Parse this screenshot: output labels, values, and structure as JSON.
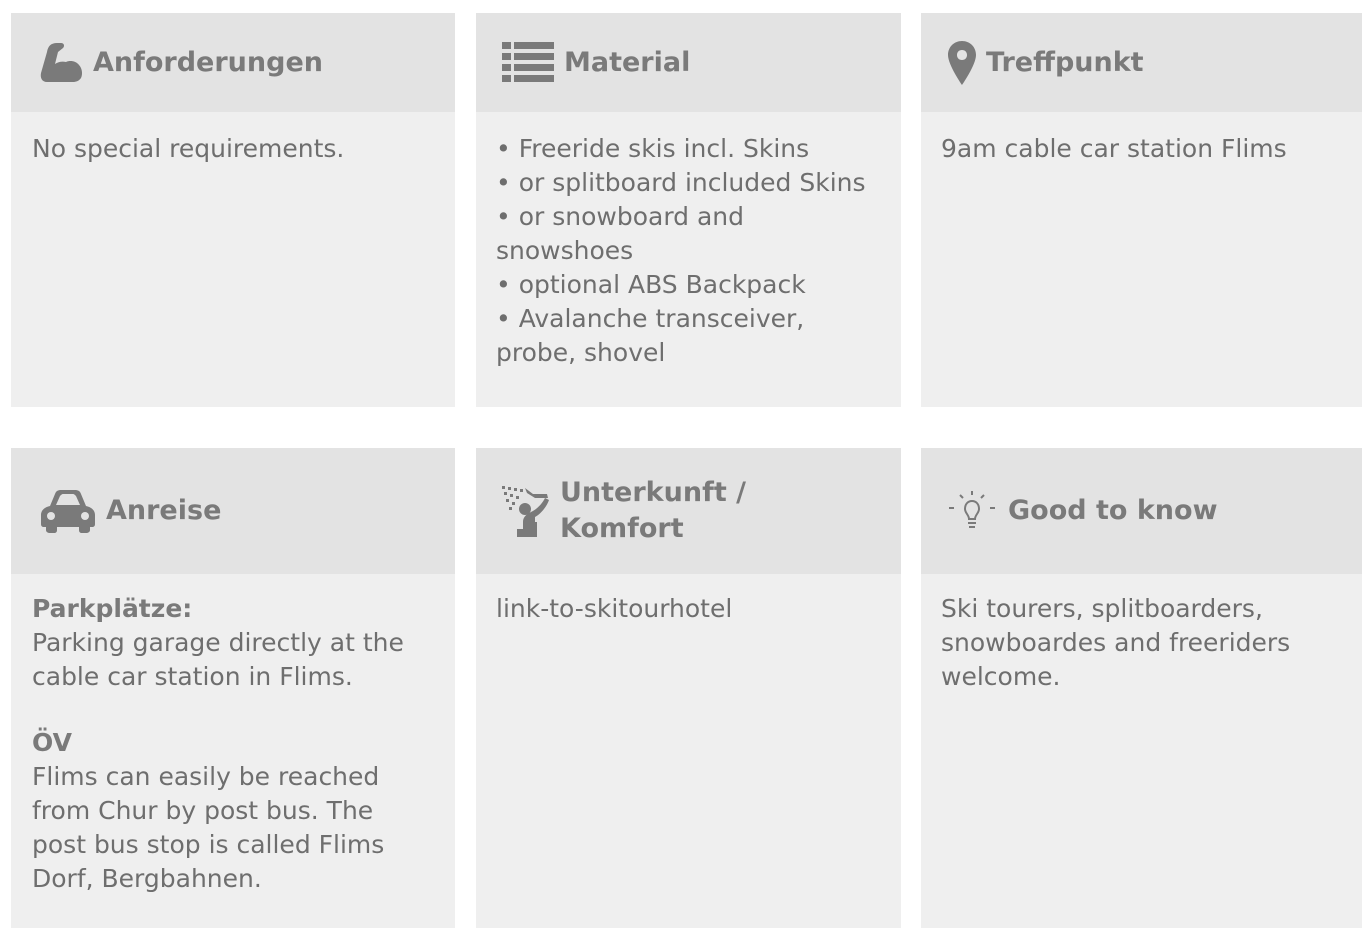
{
  "cards": {
    "requirements": {
      "title": "Anforderungen",
      "icon": "flexed-arm-icon",
      "text": "No special requirements."
    },
    "material": {
      "title": "Material",
      "icon": "list-icon",
      "items": [
        "Freeride skis incl. Skins",
        "or splitboard included Skins",
        "or snowboard and snowshoes",
        "optional ABS Backpack",
        "Avalanche transceiver, probe, shovel"
      ]
    },
    "meeting_point": {
      "title": "Treffpunkt",
      "icon": "map-pin-icon",
      "text": "9am cable car station Flims"
    },
    "arrival": {
      "title": "Anreise",
      "icon": "car-icon",
      "parking_label": "Parkplätze:",
      "parking_text": "Parking garage directly at the cable car station in Flims.",
      "public_transport_label": "ÖV",
      "public_transport_text": "Flims can easily be reached from Chur by post bus. The post bus stop is called Flims Dorf, Bergbahnen."
    },
    "accommodation": {
      "title": "Unterkunft / Komfort",
      "icon": "shower-icon",
      "link_text": "link-to-skitourhotel"
    },
    "good_to_know": {
      "title": "Good to know",
      "icon": "lightbulb-icon",
      "text": "Ski tourers, splitboarders, snowboardes and freeriders welcome."
    }
  },
  "colors": {
    "card_background": "#efefef",
    "header_background": "#e3e3e3",
    "text": "#6e6e6e",
    "icon": "#7a7a7a"
  }
}
